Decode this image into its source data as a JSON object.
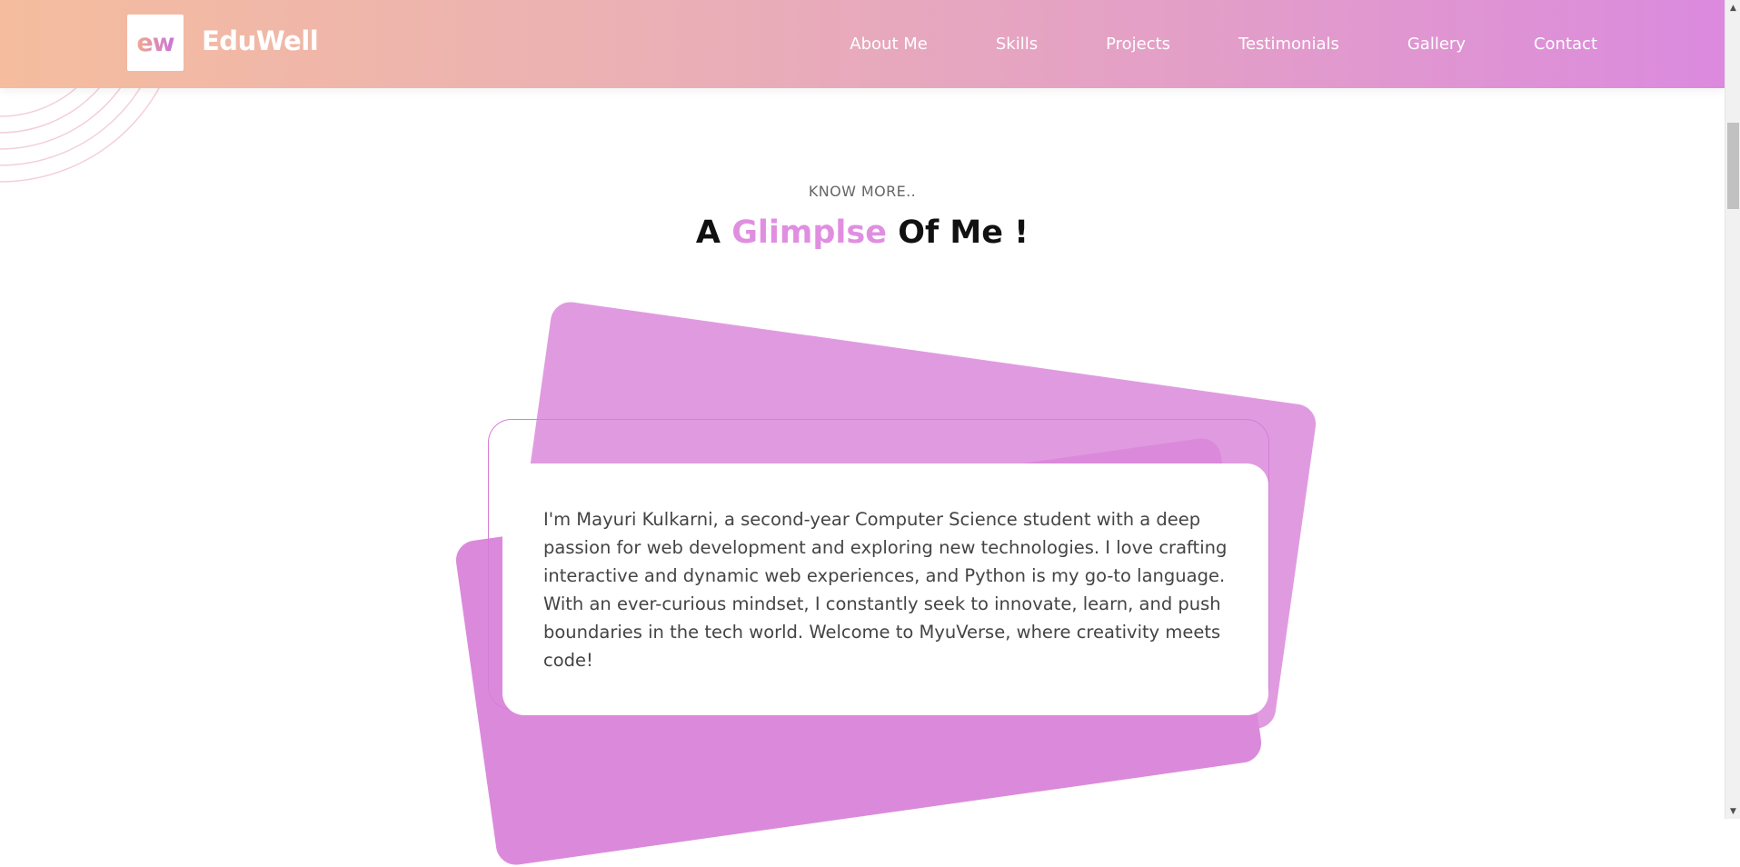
{
  "header": {
    "logo_text": "ew",
    "brand_name": "EduWell",
    "nav": [
      {
        "label": "About Me"
      },
      {
        "label": "Skills"
      },
      {
        "label": "Projects"
      },
      {
        "label": "Testimonials"
      },
      {
        "label": "Gallery"
      },
      {
        "label": "Contact"
      }
    ]
  },
  "about": {
    "eyebrow": "KNOW MORE..",
    "title_prefix": "A ",
    "title_accent": "Glimplse",
    "title_suffix": " Of Me !",
    "body": "I'm Mayuri Kulkarni, a second-year Computer Science student with a deep passion for web development and exploring new technologies. I love crafting interactive and dynamic web experiences, and Python is my go-to language. With an ever-curious mindset, I constantly seek to innovate, learn, and push boundaries in the tech world. Welcome to MyuVerse, where creativity meets code!"
  },
  "colors": {
    "accent": "#e08fe0",
    "card_back": "#e09be0",
    "card_front": "#db8adb",
    "header_start": "#f5bd9e",
    "header_end": "#db8ade"
  },
  "icons": {
    "scroll_up": "triangle-up-icon",
    "scroll_down": "triangle-down-icon"
  }
}
